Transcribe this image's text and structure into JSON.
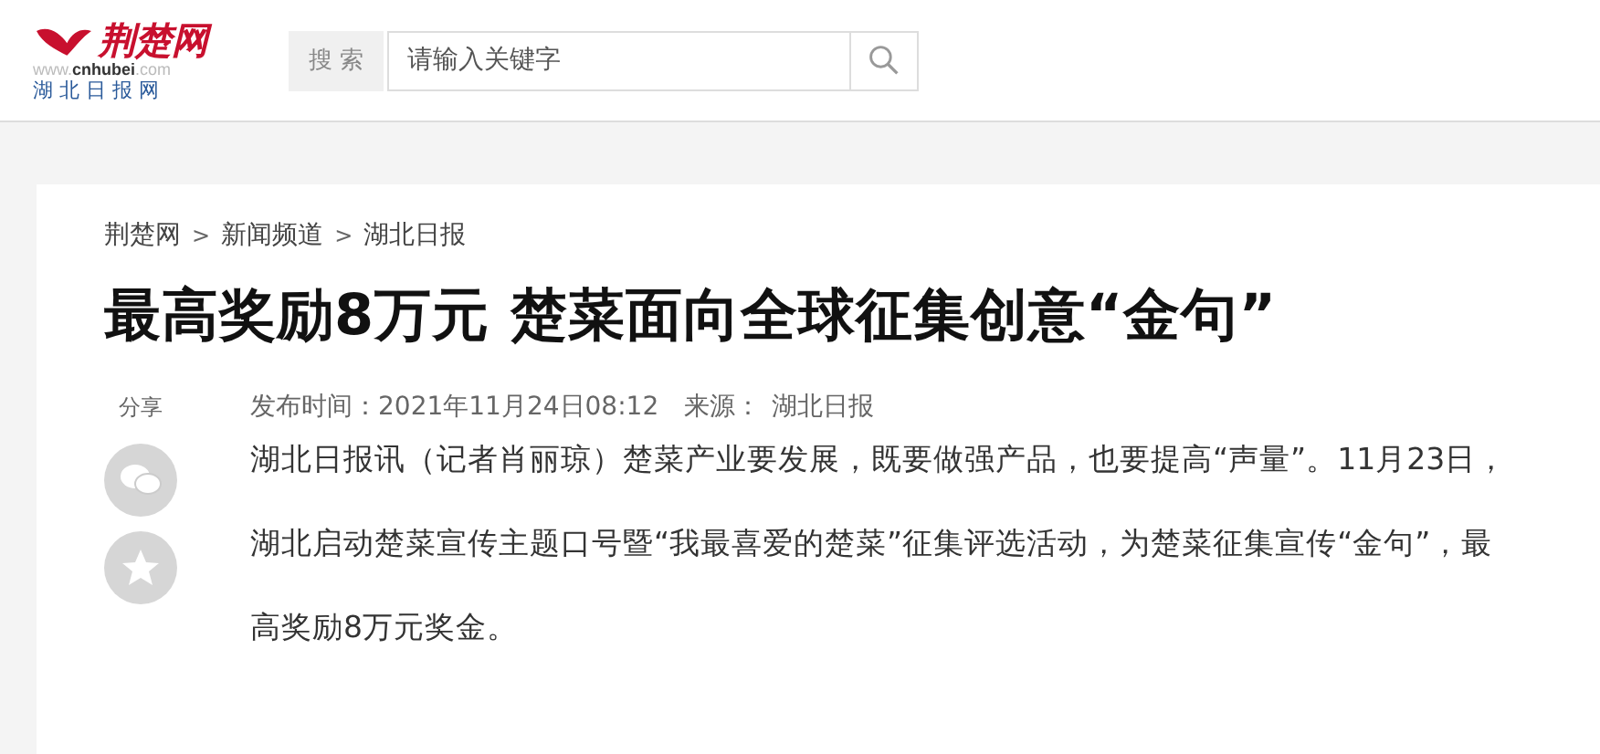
{
  "logo": {
    "name": "荆楚网",
    "domain_prefix": "www.",
    "domain_main": "cnhubei",
    "domain_suffix": ".com",
    "subtitle": "湖 北 日 报 网"
  },
  "search": {
    "label": "搜 索",
    "placeholder": "请输入关键字"
  },
  "breadcrumb": [
    "荆楚网",
    "新闻频道",
    "湖北日报"
  ],
  "breadcrumb_separator": ">",
  "title": "最高奖励8万元 楚菜面向全球征集创意“金句”",
  "share": {
    "label": "分享"
  },
  "meta": {
    "published": "发布时间：2021年11月24日08:12",
    "source_label": "来源：",
    "source": "湖北日报"
  },
  "body": "湖北日报讯（记者肖丽琼）楚菜产业要发展，既要做强产品，也要提高“声量”。11月23日，湖北启动楚菜宣传主题口号暨“我最喜爱的楚菜”征集评选活动，为楚菜征集宣传“金句”，最高奖励8万元奖金。"
}
